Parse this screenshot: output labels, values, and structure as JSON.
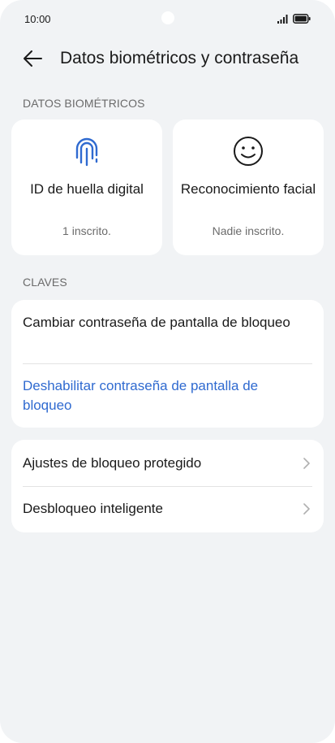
{
  "status_bar": {
    "time": "10:00"
  },
  "header": {
    "title": "Datos biométricos y contraseña"
  },
  "biometrics": {
    "section_label": "DATOS BIOMÉTRICOS",
    "fingerprint": {
      "title": "ID de huella digital",
      "subtitle": "1 inscrito.",
      "icon": "fingerprint-icon"
    },
    "face": {
      "title": "Reconocimiento facial",
      "subtitle": "Nadie inscrito.",
      "icon": "face-icon"
    }
  },
  "passwords": {
    "section_label": "CLAVES",
    "change_label": "Cambiar contraseña de pantalla de bloqueo",
    "disable_label": "Deshabilitar contraseña de pantalla de bloqueo"
  },
  "more": {
    "items": [
      {
        "label": "Ajustes de bloqueo protegido"
      },
      {
        "label": "Desbloqueo inteligente"
      }
    ]
  },
  "colors": {
    "accent": "#2f6ad0",
    "background": "#f1f3f5",
    "card": "#ffffff"
  }
}
